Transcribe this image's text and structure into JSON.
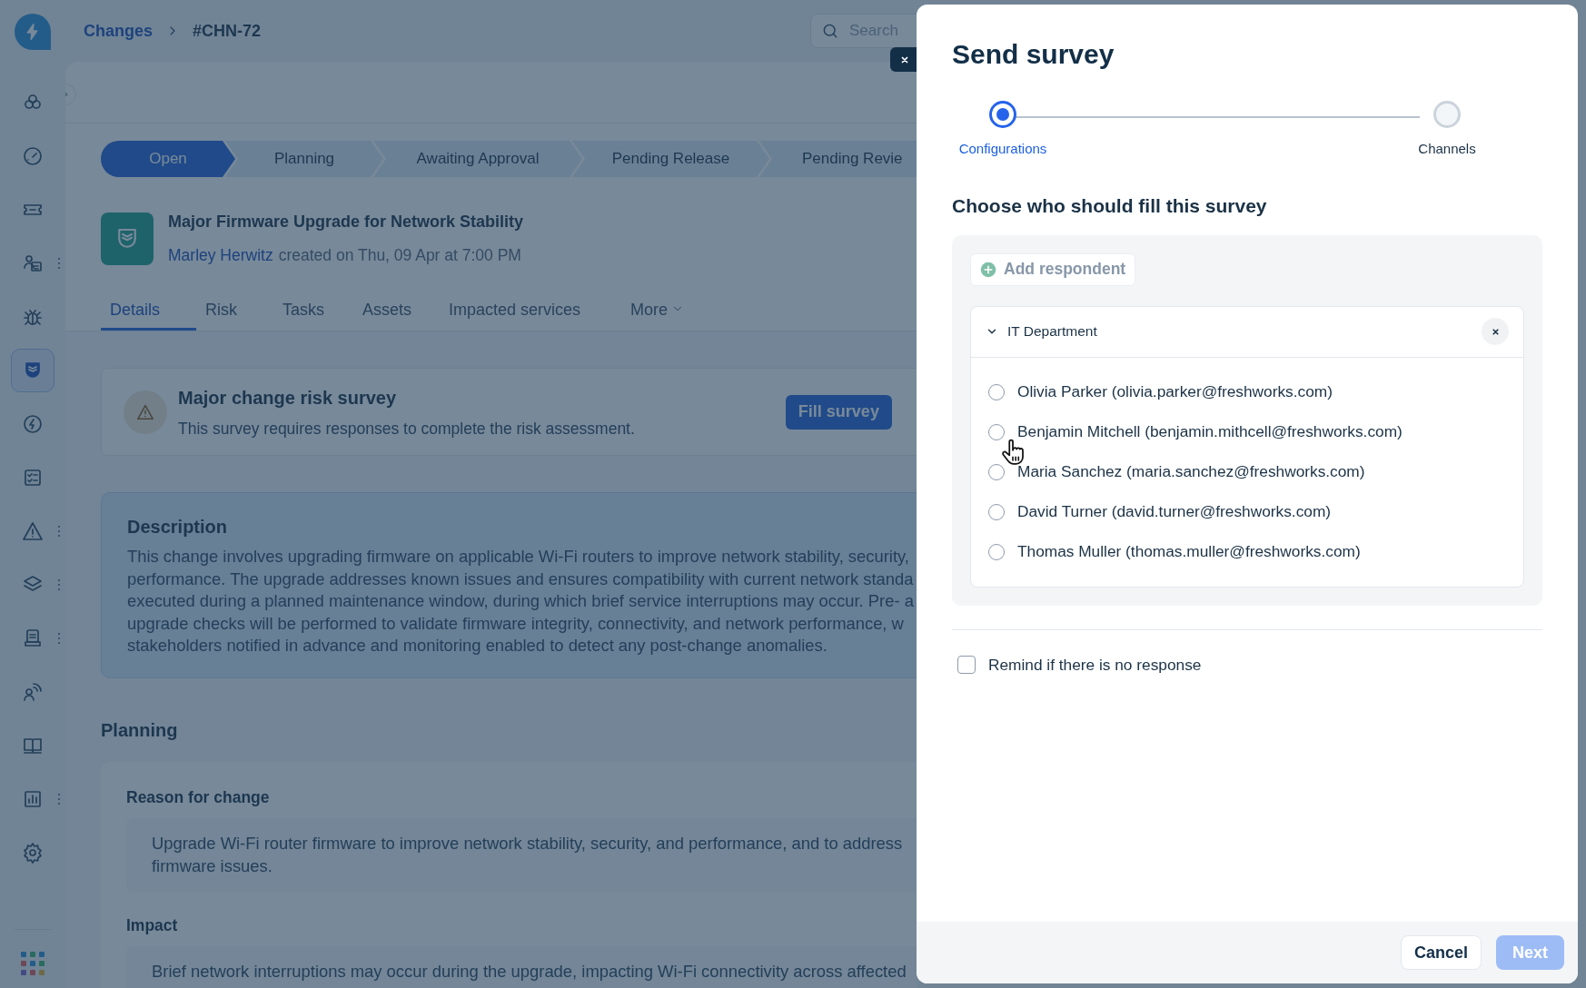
{
  "breadcrumb": {
    "parent": "Changes",
    "current": "#CHN-72"
  },
  "search": {
    "placeholder": "Search"
  },
  "sidebar": {
    "items": [
      {
        "selected": false,
        "menu": false
      },
      {
        "selected": false,
        "menu": false
      },
      {
        "selected": false,
        "menu": false
      },
      {
        "selected": false,
        "menu": true
      },
      {
        "selected": false,
        "menu": false
      },
      {
        "selected": true,
        "menu": false
      },
      {
        "selected": false,
        "menu": false
      },
      {
        "selected": false,
        "menu": false
      },
      {
        "selected": false,
        "menu": true
      },
      {
        "selected": false,
        "menu": true
      },
      {
        "selected": false,
        "menu": true
      },
      {
        "selected": false,
        "menu": false
      },
      {
        "selected": false,
        "menu": false
      },
      {
        "selected": false,
        "menu": true
      },
      {
        "selected": false,
        "menu": false
      }
    ]
  },
  "stages": [
    {
      "label": "Open",
      "selected": true
    },
    {
      "label": "Planning",
      "selected": false
    },
    {
      "label": "Awaiting Approval",
      "selected": false
    },
    {
      "label": "Pending Release",
      "selected": false
    },
    {
      "label": "Pending Revie",
      "selected": false
    }
  ],
  "record": {
    "title": "Major Firmware Upgrade for Network Stability",
    "author": "Marley Herwitz",
    "meta": "created on Thu, 09 Apr at 7:00 PM"
  },
  "tabs": [
    {
      "label": "Details",
      "selected": true,
      "kind": "tab"
    },
    {
      "label": "Risk",
      "selected": false,
      "kind": "tab"
    },
    {
      "label": "Tasks",
      "selected": false,
      "kind": "tab"
    },
    {
      "label": "Assets",
      "selected": false,
      "kind": "tab"
    },
    {
      "label": "Impacted services",
      "selected": false,
      "kind": "tab"
    },
    {
      "label": "More",
      "selected": false,
      "kind": "menu"
    }
  ],
  "survey_card": {
    "title": "Major change risk survey",
    "text": "This survey requires responses to complete the risk assessment.",
    "button": "Fill survey"
  },
  "description": {
    "title": "Description",
    "lines": [
      "This change involves upgrading firmware on applicable Wi-Fi routers to improve network stability, security,",
      "performance. The upgrade addresses known issues and ensures compatibility with current network standa",
      "executed during a planned maintenance window, during which brief service interruptions may occur. Pre- a",
      "upgrade checks will be performed to validate firmware integrity, connectivity, and network performance, w",
      "stakeholders notified in advance and monitoring enabled to detect any post-change anomalies."
    ]
  },
  "planning": {
    "title": "Planning",
    "fields": [
      {
        "label": "Reason for change",
        "lines": [
          "Upgrade Wi-Fi router firmware to improve network stability, security, and performance, and to address",
          "firmware issues."
        ]
      },
      {
        "label": "Impact",
        "lines": [
          "Brief network interruptions may occur during the upgrade, impacting Wi-Fi connectivity across affected"
        ]
      }
    ]
  },
  "drawer": {
    "title": "Send survey",
    "steps": [
      {
        "label": "Configurations",
        "selected": true
      },
      {
        "label": "Channels",
        "selected": false
      }
    ],
    "heading": "Choose who should fill this survey",
    "add_button": "Add respondent",
    "group": {
      "name": "IT Department",
      "expanded": true,
      "respondents": [
        {
          "label": "Olivia Parker (olivia.parker@freshworks.com)",
          "selected": false
        },
        {
          "label": "Benjamin Mitchell (benjamin.mithcell@freshworks.com)",
          "selected": false
        },
        {
          "label": "Maria Sanchez (maria.sanchez@freshworks.com)",
          "selected": false
        },
        {
          "label": "David Turner (david.turner@freshworks.com)",
          "selected": false
        },
        {
          "label": "Thomas Muller (thomas.muller@freshworks.com)",
          "selected": false
        }
      ]
    },
    "remind": {
      "label": "Remind if there is no response",
      "checked": false
    },
    "cancel": "Cancel",
    "next": {
      "label": "Next",
      "disabled": true
    }
  }
}
